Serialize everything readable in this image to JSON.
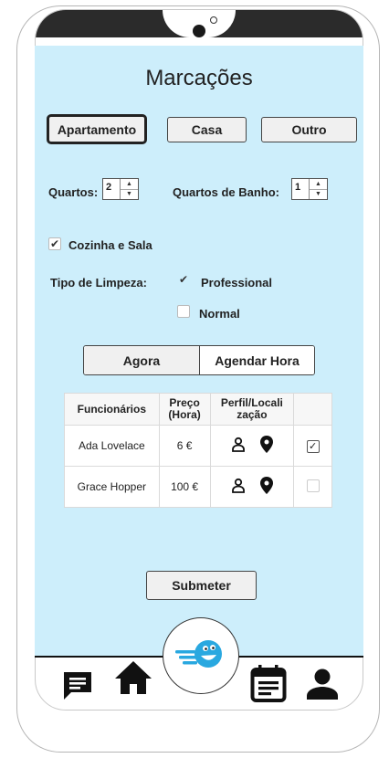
{
  "title": "Marcações",
  "property_types": [
    "Apartamento",
    "Casa",
    "Outro"
  ],
  "quartos": {
    "label": "Quartos:",
    "value": "2"
  },
  "quartos_banho": {
    "label": "Quartos de Banho:",
    "value": "1"
  },
  "kitchen": {
    "label": "Cozinha e Sala",
    "checked": true
  },
  "cleaning": {
    "label": "Tipo de Limpeza:",
    "options": [
      {
        "label": "Professional",
        "checked": true
      },
      {
        "label": "Normal",
        "checked": false
      }
    ]
  },
  "timing": [
    "Agora",
    "Agendar Hora"
  ],
  "table": {
    "headers": [
      "Funcionários",
      "Preço (Hora)",
      "Perfil/Localização",
      ""
    ],
    "header_lines": {
      "price": [
        "Preço",
        "(Hora)"
      ],
      "profile": [
        "Perfil/Locali",
        "zação"
      ]
    },
    "rows": [
      {
        "name": "Ada Lovelace",
        "price": "6 €",
        "selected": true
      },
      {
        "name": "Grace Hopper",
        "price": "100 €",
        "selected": false
      }
    ]
  },
  "submit_label": "Submeter",
  "nav_icons": [
    "chat-icon",
    "home-icon",
    "logo-icon",
    "calendar-icon",
    "profile-icon"
  ],
  "colors": {
    "screen_bg": "#cdeefb",
    "logo_blue": "#29a8e0"
  }
}
